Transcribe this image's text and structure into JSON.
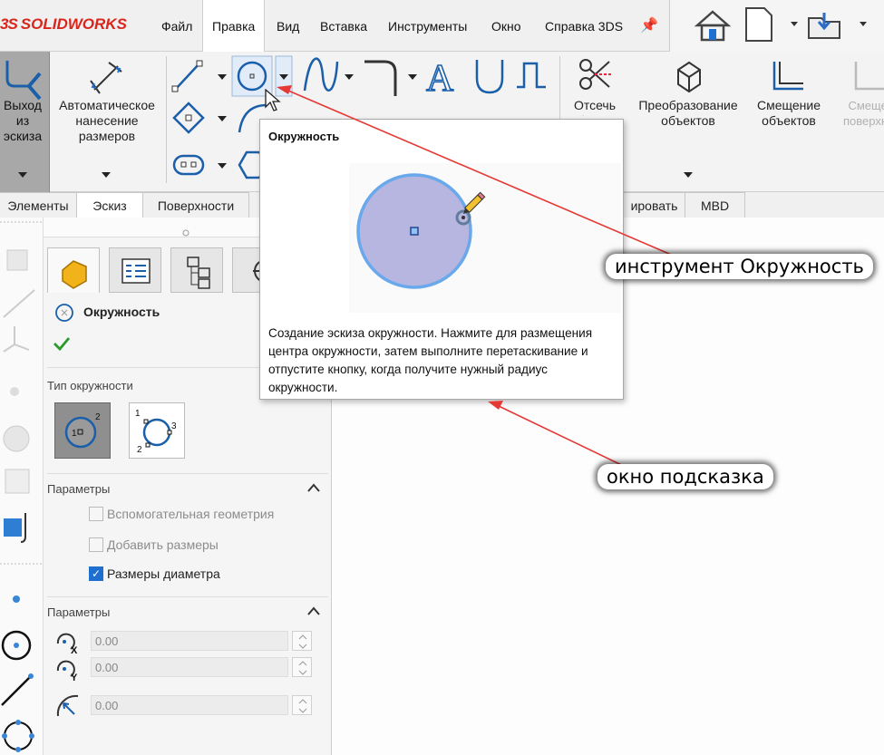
{
  "app": {
    "logo_prefix": "3S",
    "logo_text": "SOLIDWORKS"
  },
  "menu": [
    {
      "label": "Файл"
    },
    {
      "label": "Правка"
    },
    {
      "label": "Вид"
    },
    {
      "label": "Вставка"
    },
    {
      "label": "Инструменты"
    },
    {
      "label": "Окно"
    },
    {
      "label": "Справка 3DS"
    }
  ],
  "ribbon": {
    "exit_sketch": "Выход из эскиза",
    "auto_dim": "Автоматическое нанесение размеров",
    "trim": "Отсечь объекты",
    "convert": "Преобразование объектов",
    "offset": "Смещение объектов",
    "offset_surface": "Смещение поверхности"
  },
  "tabs": [
    {
      "label": "Элементы"
    },
    {
      "label": "Эскиз"
    },
    {
      "label": "Поверхности"
    },
    {
      "label": "ировать"
    },
    {
      "label": "MBD"
    }
  ],
  "panel": {
    "title": "Окружность",
    "type_section": "Тип окружности",
    "params1_title": "Параметры",
    "options": [
      {
        "label": "Вспомогательная геометрия",
        "checked": false
      },
      {
        "label": "Добавить размеры",
        "checked": false
      },
      {
        "label": "Размеры диаметра",
        "checked": true
      }
    ],
    "params2_title": "Параметры",
    "cx": "0.00",
    "cy": "0.00",
    "radius": "0.00"
  },
  "tooltip": {
    "title": "Окружность",
    "description": "Создание эскиза окружности. Нажмите для размещения центра окружности, затем выполните перетаскивание и отпустите кнопку, когда получите нужный радиус окружности."
  },
  "annotations": {
    "tool_label": "инструмент Окружность",
    "tooltip_label": "окно подсказка"
  },
  "colors": {
    "accent_red": "#e53935",
    "check_blue": "#1f6fd1",
    "circle_fill": "#b7b6e0",
    "circle_stroke": "#6aa8ec"
  }
}
